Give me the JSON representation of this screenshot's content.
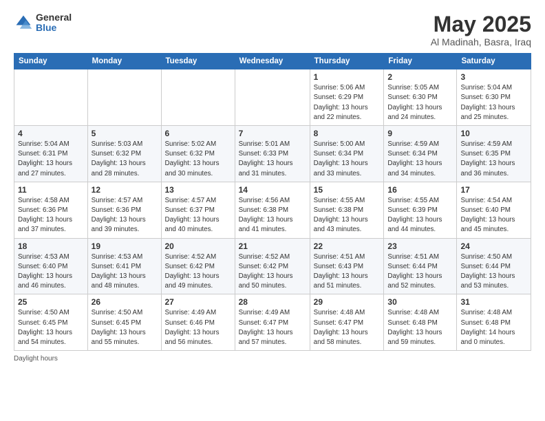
{
  "header": {
    "logo_general": "General",
    "logo_blue": "Blue",
    "title": "May 2025",
    "subtitle": "Al Madinah, Basra, Iraq"
  },
  "days_of_week": [
    "Sunday",
    "Monday",
    "Tuesday",
    "Wednesday",
    "Thursday",
    "Friday",
    "Saturday"
  ],
  "weeks": [
    [
      {
        "num": "",
        "info": ""
      },
      {
        "num": "",
        "info": ""
      },
      {
        "num": "",
        "info": ""
      },
      {
        "num": "",
        "info": ""
      },
      {
        "num": "1",
        "info": "Sunrise: 5:06 AM\nSunset: 6:29 PM\nDaylight: 13 hours\nand 22 minutes."
      },
      {
        "num": "2",
        "info": "Sunrise: 5:05 AM\nSunset: 6:30 PM\nDaylight: 13 hours\nand 24 minutes."
      },
      {
        "num": "3",
        "info": "Sunrise: 5:04 AM\nSunset: 6:30 PM\nDaylight: 13 hours\nand 25 minutes."
      }
    ],
    [
      {
        "num": "4",
        "info": "Sunrise: 5:04 AM\nSunset: 6:31 PM\nDaylight: 13 hours\nand 27 minutes."
      },
      {
        "num": "5",
        "info": "Sunrise: 5:03 AM\nSunset: 6:32 PM\nDaylight: 13 hours\nand 28 minutes."
      },
      {
        "num": "6",
        "info": "Sunrise: 5:02 AM\nSunset: 6:32 PM\nDaylight: 13 hours\nand 30 minutes."
      },
      {
        "num": "7",
        "info": "Sunrise: 5:01 AM\nSunset: 6:33 PM\nDaylight: 13 hours\nand 31 minutes."
      },
      {
        "num": "8",
        "info": "Sunrise: 5:00 AM\nSunset: 6:34 PM\nDaylight: 13 hours\nand 33 minutes."
      },
      {
        "num": "9",
        "info": "Sunrise: 4:59 AM\nSunset: 6:34 PM\nDaylight: 13 hours\nand 34 minutes."
      },
      {
        "num": "10",
        "info": "Sunrise: 4:59 AM\nSunset: 6:35 PM\nDaylight: 13 hours\nand 36 minutes."
      }
    ],
    [
      {
        "num": "11",
        "info": "Sunrise: 4:58 AM\nSunset: 6:36 PM\nDaylight: 13 hours\nand 37 minutes."
      },
      {
        "num": "12",
        "info": "Sunrise: 4:57 AM\nSunset: 6:36 PM\nDaylight: 13 hours\nand 39 minutes."
      },
      {
        "num": "13",
        "info": "Sunrise: 4:57 AM\nSunset: 6:37 PM\nDaylight: 13 hours\nand 40 minutes."
      },
      {
        "num": "14",
        "info": "Sunrise: 4:56 AM\nSunset: 6:38 PM\nDaylight: 13 hours\nand 41 minutes."
      },
      {
        "num": "15",
        "info": "Sunrise: 4:55 AM\nSunset: 6:38 PM\nDaylight: 13 hours\nand 43 minutes."
      },
      {
        "num": "16",
        "info": "Sunrise: 4:55 AM\nSunset: 6:39 PM\nDaylight: 13 hours\nand 44 minutes."
      },
      {
        "num": "17",
        "info": "Sunrise: 4:54 AM\nSunset: 6:40 PM\nDaylight: 13 hours\nand 45 minutes."
      }
    ],
    [
      {
        "num": "18",
        "info": "Sunrise: 4:53 AM\nSunset: 6:40 PM\nDaylight: 13 hours\nand 46 minutes."
      },
      {
        "num": "19",
        "info": "Sunrise: 4:53 AM\nSunset: 6:41 PM\nDaylight: 13 hours\nand 48 minutes."
      },
      {
        "num": "20",
        "info": "Sunrise: 4:52 AM\nSunset: 6:42 PM\nDaylight: 13 hours\nand 49 minutes."
      },
      {
        "num": "21",
        "info": "Sunrise: 4:52 AM\nSunset: 6:42 PM\nDaylight: 13 hours\nand 50 minutes."
      },
      {
        "num": "22",
        "info": "Sunrise: 4:51 AM\nSunset: 6:43 PM\nDaylight: 13 hours\nand 51 minutes."
      },
      {
        "num": "23",
        "info": "Sunrise: 4:51 AM\nSunset: 6:44 PM\nDaylight: 13 hours\nand 52 minutes."
      },
      {
        "num": "24",
        "info": "Sunrise: 4:50 AM\nSunset: 6:44 PM\nDaylight: 13 hours\nand 53 minutes."
      }
    ],
    [
      {
        "num": "25",
        "info": "Sunrise: 4:50 AM\nSunset: 6:45 PM\nDaylight: 13 hours\nand 54 minutes."
      },
      {
        "num": "26",
        "info": "Sunrise: 4:50 AM\nSunset: 6:45 PM\nDaylight: 13 hours\nand 55 minutes."
      },
      {
        "num": "27",
        "info": "Sunrise: 4:49 AM\nSunset: 6:46 PM\nDaylight: 13 hours\nand 56 minutes."
      },
      {
        "num": "28",
        "info": "Sunrise: 4:49 AM\nSunset: 6:47 PM\nDaylight: 13 hours\nand 57 minutes."
      },
      {
        "num": "29",
        "info": "Sunrise: 4:48 AM\nSunset: 6:47 PM\nDaylight: 13 hours\nand 58 minutes."
      },
      {
        "num": "30",
        "info": "Sunrise: 4:48 AM\nSunset: 6:48 PM\nDaylight: 13 hours\nand 59 minutes."
      },
      {
        "num": "31",
        "info": "Sunrise: 4:48 AM\nSunset: 6:48 PM\nDaylight: 14 hours\nand 0 minutes."
      }
    ]
  ],
  "footer": {
    "daylight_label": "Daylight hours"
  }
}
